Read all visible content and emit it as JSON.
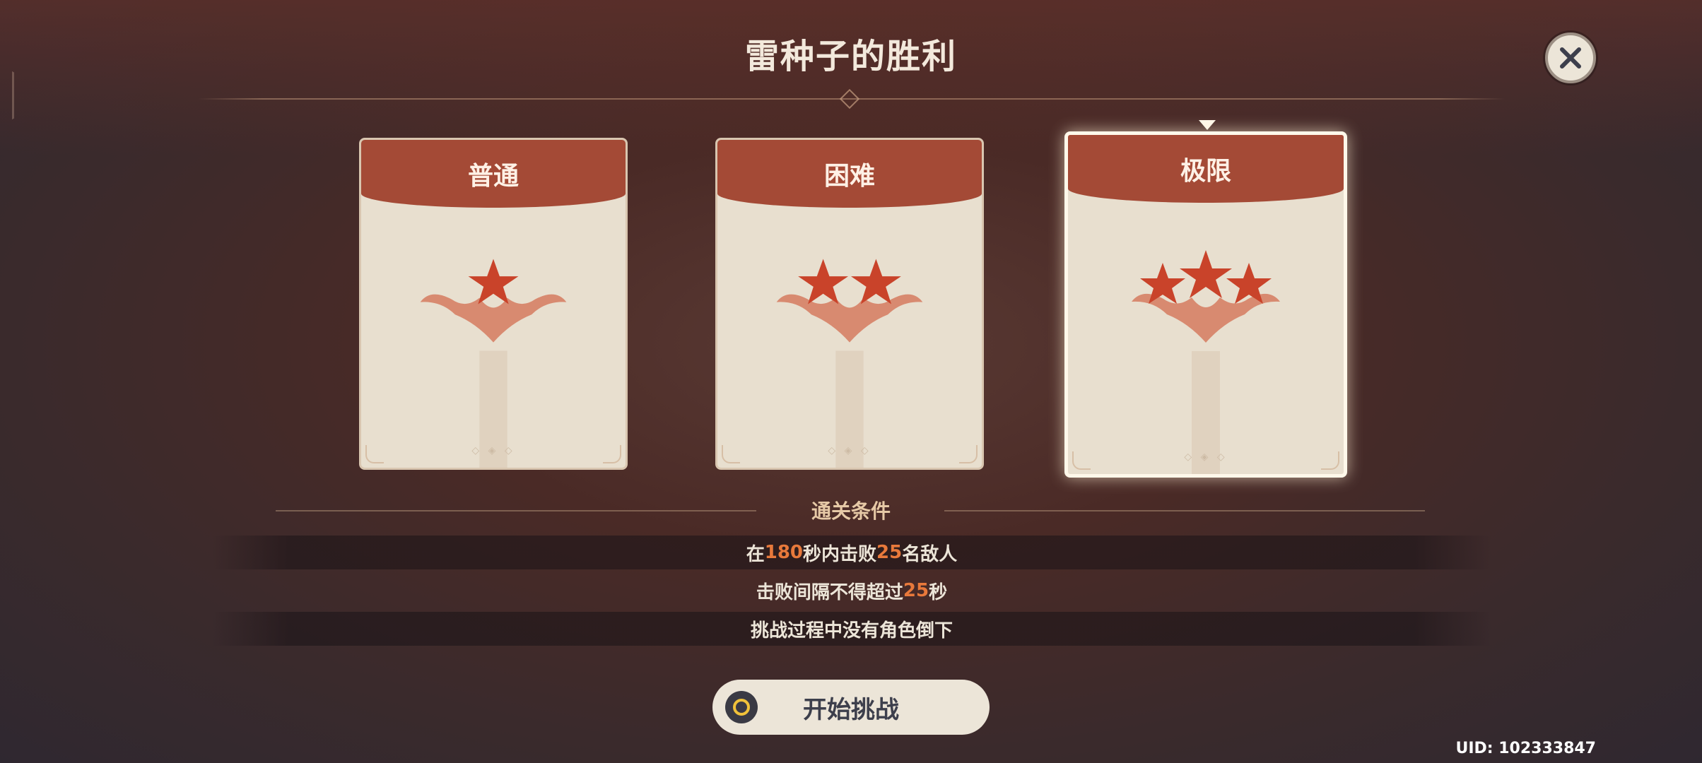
{
  "header": {
    "title": "雷种子的胜利"
  },
  "difficulties": [
    {
      "label": "普通",
      "stars": 1,
      "selected": false
    },
    {
      "label": "困难",
      "stars": 2,
      "selected": false
    },
    {
      "label": "极限",
      "stars": 3,
      "selected": true
    }
  ],
  "conditions": {
    "title": "通关条件",
    "items": [
      {
        "prefix": "在",
        "num1": "180",
        "mid": "秒内击败",
        "num2": "25",
        "suffix": "名敌人"
      },
      {
        "prefix": "击败间隔不得超过",
        "num1": "25",
        "mid": "秒",
        "num2": "",
        "suffix": ""
      },
      {
        "prefix": "挑战过程中没有角色倒下",
        "num1": "",
        "mid": "",
        "num2": "",
        "suffix": ""
      }
    ]
  },
  "start_button": {
    "label": "开始挑战"
  },
  "uid": "UID: 102333847",
  "colors": {
    "card_header": "#a44a36",
    "star": "#c9432a",
    "highlight": "#e8793b",
    "button_bg": "#ece5d8"
  },
  "icons": {
    "close": "close-icon",
    "start": "controller-button-icon",
    "star": "star-icon"
  }
}
